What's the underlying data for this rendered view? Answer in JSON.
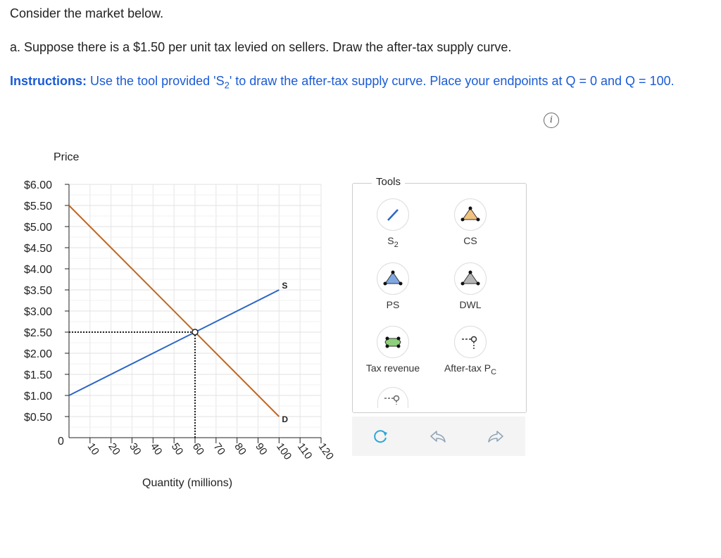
{
  "question": {
    "intro": "Consider the market below.",
    "part_a": "a. Suppose there is a $1.50 per unit tax levied on sellers. Draw the after-tax supply curve.",
    "instructions_label": "Instructions:",
    "instructions_text": "Use the tool provided 'S2' to draw the after-tax supply curve. Place your endpoints at Q = 0 and Q = 100."
  },
  "chart_data": {
    "type": "line",
    "ylabel": "Price",
    "xlabel": "Quantity (millions)",
    "origin_label": "0",
    "y_ticks": [
      "$6.00",
      "$5.50",
      "$5.00",
      "$4.50",
      "$4.00",
      "$3.50",
      "$3.00",
      "$2.50",
      "$2.00",
      "$1.50",
      "$1.00",
      "$0.50"
    ],
    "x_ticks": [
      "10",
      "20",
      "30",
      "40",
      "50",
      "60",
      "70",
      "80",
      "90",
      "100",
      "110",
      "120"
    ],
    "xlim": [
      0,
      120
    ],
    "ylim": [
      0,
      6
    ],
    "series": [
      {
        "name": "S",
        "color": "#2b66c4",
        "points": [
          [
            0,
            1.0
          ],
          [
            100,
            3.5
          ]
        ]
      },
      {
        "name": "D",
        "color": "#c0661f",
        "points": [
          [
            0,
            5.5
          ],
          [
            100,
            0.5
          ]
        ]
      }
    ],
    "equilibrium": {
      "q": 60,
      "p": 2.5
    }
  },
  "tools": {
    "title": "Tools",
    "items": [
      {
        "label": "S2"
      },
      {
        "label": "CS"
      },
      {
        "label": "PS"
      },
      {
        "label": "DWL"
      },
      {
        "label": "Tax revenue"
      },
      {
        "label": "After-tax PC"
      },
      {
        "label": ""
      }
    ]
  },
  "colors": {
    "instructions": "#1a5bd6",
    "supply": "#2b66c4",
    "demand": "#c0661f"
  }
}
